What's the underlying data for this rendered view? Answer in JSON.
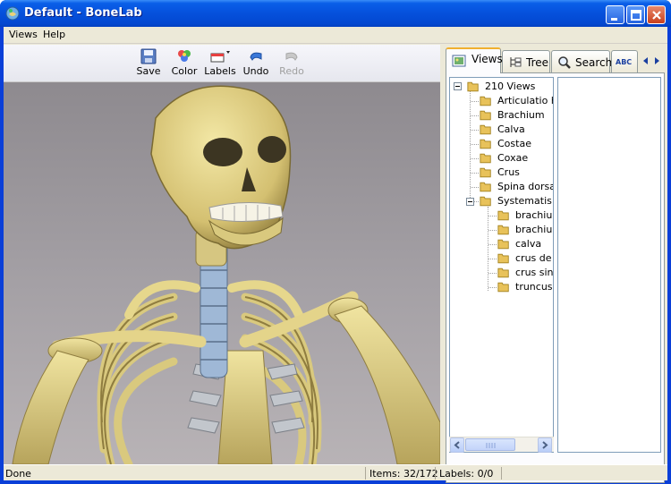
{
  "window": {
    "title": "Default - BoneLab"
  },
  "menu": {
    "items": [
      "Views",
      "Help"
    ]
  },
  "toolbar": {
    "save": "Save",
    "color": "Color",
    "labels": "Labels",
    "undo": "Undo",
    "redo": "Redo"
  },
  "tabs": [
    {
      "label": "Views",
      "icon": "views-icon",
      "active": true
    },
    {
      "label": "Tree",
      "icon": "tree-icon",
      "active": false
    },
    {
      "label": "Search",
      "icon": "search-icon",
      "active": false
    },
    {
      "label": "ABC",
      "icon": "abc-icon",
      "active": false
    }
  ],
  "tree": {
    "root": "210 Views",
    "children": [
      "Articulatio h",
      "Brachium",
      "Calva",
      "Costae",
      "Coxae",
      "Crus",
      "Spina dorsa",
      "Systematis"
    ],
    "subchildren": [
      "brachiu",
      "brachiu",
      "calva",
      "crus de",
      "crus sin",
      "truncus"
    ]
  },
  "status": {
    "state": "Done",
    "items": "Items: 32/172",
    "labels": "Labels: 0/0"
  },
  "colors": {
    "folder": "#e8c25a",
    "bone": "#e2d389",
    "titlebar": "#0550dc"
  }
}
